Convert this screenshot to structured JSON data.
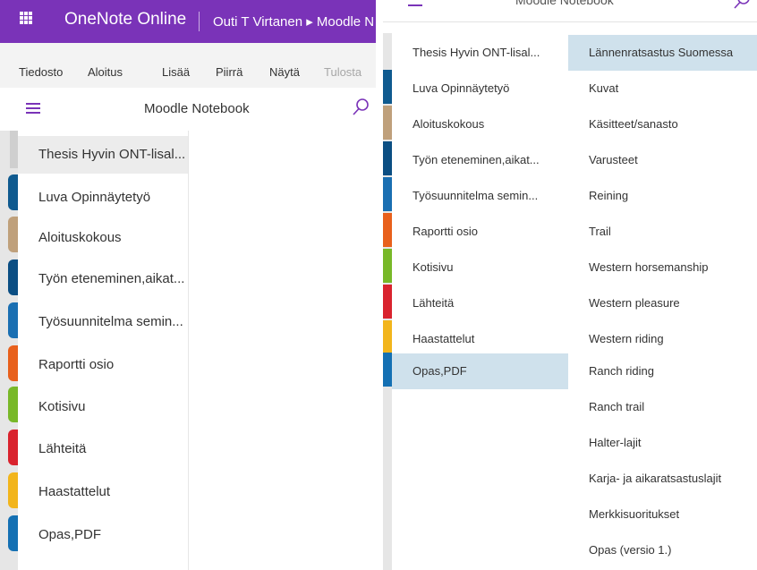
{
  "left": {
    "app": {
      "name": "OneNote Online",
      "breadcrumb": "Outi T Virtanen ▸ Moodle N"
    },
    "ribbon": [
      "Tiedosto",
      "Aloitus",
      "Lisää",
      "Piirrä",
      "Näytä",
      "Tulosta"
    ],
    "notebook_title": "Moodle Notebook",
    "sections": [
      {
        "label": "Thesis Hyvin ONT-lisal...",
        "color": "#c8c8c8",
        "selected": true
      },
      {
        "label": "Luva Opinnäytetyö",
        "color": "#0f5a8f"
      },
      {
        "label": "Aloituskokous",
        "color": "#bfa07b"
      },
      {
        "label": "Työn eteneminen,aikat...",
        "color": "#0b4e83"
      },
      {
        "label": "Työsuunnitelma semin...",
        "color": "#1a6fb2"
      },
      {
        "label": "Raportti osio",
        "color": "#e8601c"
      },
      {
        "label": "Kotisivu",
        "color": "#78b828"
      },
      {
        "label": "Lähteitä",
        "color": "#d9232e"
      },
      {
        "label": "Haastattelut",
        "color": "#f2b51c"
      },
      {
        "label": "Opas,PDF",
        "color": "#1470b3"
      }
    ]
  },
  "right": {
    "notebook_title": "Moodle Notebook",
    "sections": [
      {
        "label": "Thesis Hyvin ONT-lisal...",
        "color": "#c8c8c8"
      },
      {
        "label": "Luva Opinnäytetyö",
        "color": "#0f5a8f"
      },
      {
        "label": "Aloituskokous",
        "color": "#bfa07b"
      },
      {
        "label": "Työn eteneminen,aikat...",
        "color": "#0b4e83"
      },
      {
        "label": "Työsuunnitelma semin...",
        "color": "#1a6fb2"
      },
      {
        "label": "Raportti osio",
        "color": "#e8601c"
      },
      {
        "label": "Kotisivu",
        "color": "#78b828"
      },
      {
        "label": "Lähteitä",
        "color": "#d9232e"
      },
      {
        "label": "Haastattelut",
        "color": "#f2b51c"
      },
      {
        "label": "Opas,PDF",
        "color": "#1470b3",
        "selected": true
      }
    ],
    "pages": [
      {
        "label": "Lännenratsastus Suomessa",
        "selected": true
      },
      {
        "label": "Kuvat"
      },
      {
        "label": "Käsitteet/sanasto"
      },
      {
        "label": "Varusteet"
      },
      {
        "label": "Reining"
      },
      {
        "label": "Trail"
      },
      {
        "label": "Western horsemanship"
      },
      {
        "label": "Western pleasure"
      },
      {
        "label": "Western riding"
      },
      {
        "label": "Ranch riding"
      },
      {
        "label": "Ranch trail"
      },
      {
        "label": "Halter-lajit"
      },
      {
        "label": "Karja- ja aikaratsastuslajit"
      },
      {
        "label": "Merkkisuoritukset"
      },
      {
        "label": "Opas (versio 1.)"
      }
    ]
  },
  "icons": {
    "app_launcher": "waffle-icon",
    "nav_menu": "hamburger-icon",
    "search": "search-icon"
  },
  "colors": {
    "brand_purple": "#7a33b8",
    "selection_blue": "#cfe1ec"
  }
}
